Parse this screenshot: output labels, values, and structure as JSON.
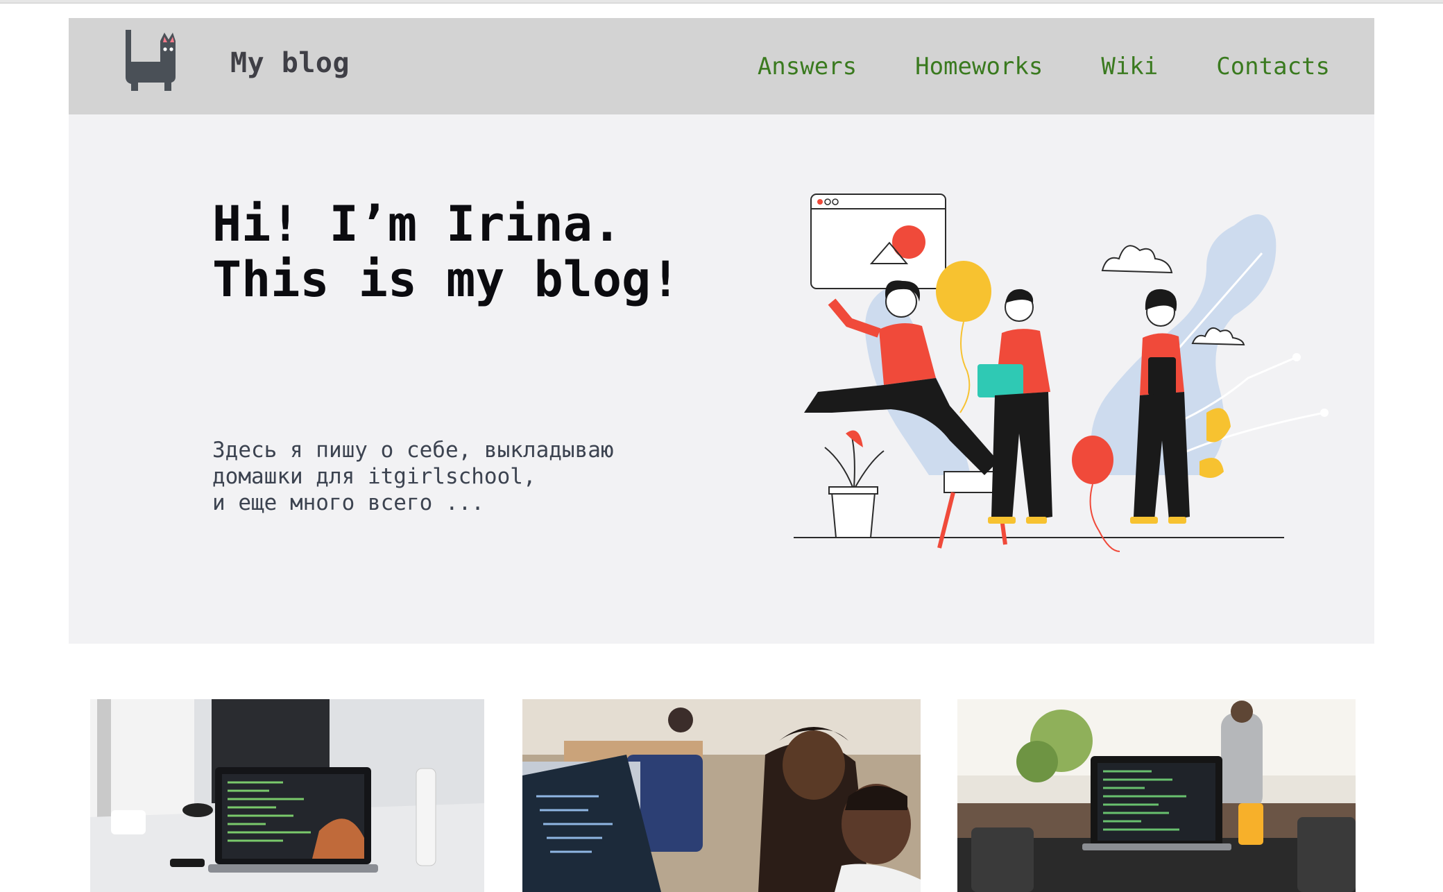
{
  "site": {
    "title": "My blog"
  },
  "nav": [
    {
      "label": "Answers"
    },
    {
      "label": "Homeworks"
    },
    {
      "label": "Wiki"
    },
    {
      "label": "Contacts"
    }
  ],
  "hero": {
    "title_lines": [
      "Hi! I’m Irina.",
      "This is my blog!"
    ],
    "text_lines": [
      "Здесь я пишу о себе, выкладываю",
      "домашки для itgirlschool,",
      "и еще много всего ..."
    ]
  },
  "colors": {
    "header_bg": "#d3d3d3",
    "hero_bg": "#f2f2f4",
    "nav_link": "#3a7a1f",
    "accent_red": "#f04a3a",
    "accent_yellow": "#f7c230",
    "accent_teal": "#2fc9b4",
    "blob_blue": "#cddbee"
  },
  "icons": {
    "logo": "cat-icon"
  }
}
